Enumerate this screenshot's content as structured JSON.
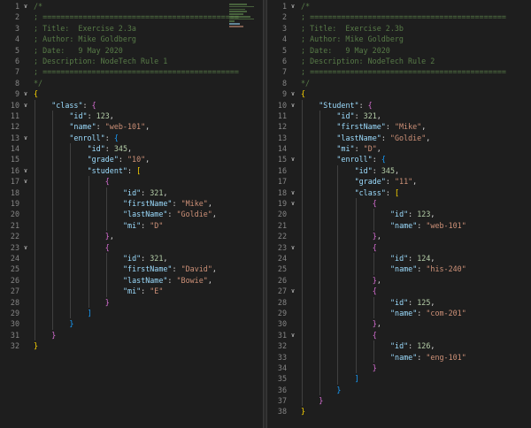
{
  "editors": [
    {
      "name": "left",
      "lines": [
        {
          "n": "1",
          "fold": true,
          "indent": 0,
          "tokens": [
            [
              "comment",
              "/*"
            ]
          ]
        },
        {
          "n": "2",
          "indent": 0,
          "tokens": [
            [
              "comment",
              "; ============================================"
            ]
          ]
        },
        {
          "n": "3",
          "indent": 0,
          "tokens": [
            [
              "comment",
              "; Title:  Exercise 2.3a"
            ]
          ]
        },
        {
          "n": "4",
          "indent": 0,
          "tokens": [
            [
              "comment",
              "; Author: Mike Goldberg"
            ]
          ]
        },
        {
          "n": "5",
          "indent": 0,
          "tokens": [
            [
              "comment",
              "; Date:   9 May 2020"
            ]
          ]
        },
        {
          "n": "6",
          "indent": 0,
          "tokens": [
            [
              "comment",
              "; Description: NodeTech Rule 1"
            ]
          ]
        },
        {
          "n": "7",
          "indent": 0,
          "tokens": [
            [
              "comment",
              "; ============================================"
            ]
          ]
        },
        {
          "n": "8",
          "indent": 0,
          "tokens": [
            [
              "comment",
              "*/"
            ]
          ]
        },
        {
          "n": "9",
          "fold": true,
          "indent": 0,
          "tokens": [
            [
              "b1",
              "{"
            ]
          ]
        },
        {
          "n": "10",
          "fold": true,
          "indent": 1,
          "tokens": [
            [
              "key",
              "\"class\""
            ],
            [
              "punc",
              ": "
            ],
            [
              "b2",
              "{"
            ]
          ]
        },
        {
          "n": "11",
          "indent": 2,
          "tokens": [
            [
              "key",
              "\"id\""
            ],
            [
              "punc",
              ": "
            ],
            [
              "num",
              "123"
            ],
            [
              "punc",
              ","
            ]
          ]
        },
        {
          "n": "12",
          "indent": 2,
          "tokens": [
            [
              "key",
              "\"name\""
            ],
            [
              "punc",
              ": "
            ],
            [
              "str",
              "\"web-101\""
            ],
            [
              "punc",
              ","
            ]
          ]
        },
        {
          "n": "13",
          "fold": true,
          "indent": 2,
          "tokens": [
            [
              "key",
              "\"enroll\""
            ],
            [
              "punc",
              ": "
            ],
            [
              "b3",
              "{"
            ]
          ]
        },
        {
          "n": "14",
          "indent": 3,
          "tokens": [
            [
              "key",
              "\"id\""
            ],
            [
              "punc",
              ": "
            ],
            [
              "num",
              "345"
            ],
            [
              "punc",
              ","
            ]
          ]
        },
        {
          "n": "15",
          "indent": 3,
          "tokens": [
            [
              "key",
              "\"grade\""
            ],
            [
              "punc",
              ": "
            ],
            [
              "str",
              "\"10\""
            ],
            [
              "punc",
              ","
            ]
          ]
        },
        {
          "n": "16",
          "fold": true,
          "indent": 3,
          "tokens": [
            [
              "key",
              "\"student\""
            ],
            [
              "punc",
              ": "
            ],
            [
              "b1",
              "["
            ]
          ]
        },
        {
          "n": "17",
          "fold": true,
          "indent": 4,
          "tokens": [
            [
              "b2",
              "{"
            ]
          ]
        },
        {
          "n": "18",
          "indent": 5,
          "tokens": [
            [
              "key",
              "\"id\""
            ],
            [
              "punc",
              ": "
            ],
            [
              "num",
              "321"
            ],
            [
              "punc",
              ","
            ]
          ]
        },
        {
          "n": "19",
          "indent": 5,
          "tokens": [
            [
              "key",
              "\"firstName\""
            ],
            [
              "punc",
              ": "
            ],
            [
              "str",
              "\"Mike\""
            ],
            [
              "punc",
              ","
            ]
          ]
        },
        {
          "n": "20",
          "indent": 5,
          "tokens": [
            [
              "key",
              "\"lastName\""
            ],
            [
              "punc",
              ": "
            ],
            [
              "str",
              "\"Goldie\""
            ],
            [
              "punc",
              ","
            ]
          ]
        },
        {
          "n": "21",
          "indent": 5,
          "tokens": [
            [
              "key",
              "\"mi\""
            ],
            [
              "punc",
              ": "
            ],
            [
              "str",
              "\"D\""
            ]
          ]
        },
        {
          "n": "22",
          "indent": 4,
          "tokens": [
            [
              "b2",
              "}"
            ],
            [
              "punc",
              ","
            ]
          ]
        },
        {
          "n": "23",
          "fold": true,
          "indent": 4,
          "tokens": [
            [
              "b2",
              "{"
            ]
          ]
        },
        {
          "n": "24",
          "indent": 5,
          "tokens": [
            [
              "key",
              "\"id\""
            ],
            [
              "punc",
              ": "
            ],
            [
              "num",
              "321"
            ],
            [
              "punc",
              ","
            ]
          ]
        },
        {
          "n": "25",
          "indent": 5,
          "tokens": [
            [
              "key",
              "\"firstName\""
            ],
            [
              "punc",
              ": "
            ],
            [
              "str",
              "\"David\""
            ],
            [
              "punc",
              ","
            ]
          ]
        },
        {
          "n": "26",
          "indent": 5,
          "tokens": [
            [
              "key",
              "\"lastName\""
            ],
            [
              "punc",
              ": "
            ],
            [
              "str",
              "\"Bowie\""
            ],
            [
              "punc",
              ","
            ]
          ]
        },
        {
          "n": "27",
          "indent": 5,
          "tokens": [
            [
              "key",
              "\"mi\""
            ],
            [
              "punc",
              ": "
            ],
            [
              "str",
              "\"E\""
            ]
          ]
        },
        {
          "n": "28",
          "indent": 4,
          "tokens": [
            [
              "b2",
              "}"
            ]
          ]
        },
        {
          "n": "29",
          "indent": 3,
          "tokens": [
            [
              "b3",
              "]"
            ]
          ]
        },
        {
          "n": "30",
          "indent": 2,
          "tokens": [
            [
              "b3",
              "}"
            ]
          ]
        },
        {
          "n": "31",
          "indent": 1,
          "tokens": [
            [
              "b2",
              "}"
            ]
          ]
        },
        {
          "n": "32",
          "indent": 0,
          "tokens": [
            [
              "b1",
              "}"
            ]
          ]
        }
      ]
    },
    {
      "name": "right",
      "lines": [
        {
          "n": "1",
          "fold": true,
          "indent": 0,
          "tokens": [
            [
              "comment",
              "/*"
            ]
          ]
        },
        {
          "n": "2",
          "indent": 0,
          "tokens": [
            [
              "comment",
              "; ============================================"
            ]
          ]
        },
        {
          "n": "3",
          "indent": 0,
          "tokens": [
            [
              "comment",
              "; Title:  Exercise 2.3b"
            ]
          ]
        },
        {
          "n": "4",
          "indent": 0,
          "tokens": [
            [
              "comment",
              "; Author: Mike Goldberg"
            ]
          ]
        },
        {
          "n": "5",
          "indent": 0,
          "tokens": [
            [
              "comment",
              "; Date:   9 May 2020"
            ]
          ]
        },
        {
          "n": "6",
          "indent": 0,
          "tokens": [
            [
              "comment",
              "; Description: NodeTech Rule 2"
            ]
          ]
        },
        {
          "n": "7",
          "indent": 0,
          "tokens": [
            [
              "comment",
              "; ============================================"
            ]
          ]
        },
        {
          "n": "8",
          "indent": 0,
          "tokens": [
            [
              "comment",
              "*/"
            ]
          ]
        },
        {
          "n": "9",
          "fold": true,
          "indent": 0,
          "tokens": [
            [
              "b1",
              "{"
            ]
          ]
        },
        {
          "n": "10",
          "fold": true,
          "indent": 1,
          "tokens": [
            [
              "key",
              "\"Student\""
            ],
            [
              "punc",
              ": "
            ],
            [
              "b2",
              "{"
            ]
          ]
        },
        {
          "n": "11",
          "indent": 2,
          "tokens": [
            [
              "key",
              "\"id\""
            ],
            [
              "punc",
              ": "
            ],
            [
              "num",
              "321"
            ],
            [
              "punc",
              ","
            ]
          ]
        },
        {
          "n": "12",
          "indent": 2,
          "tokens": [
            [
              "key",
              "\"firstName\""
            ],
            [
              "punc",
              ": "
            ],
            [
              "str",
              "\"Mike\""
            ],
            [
              "punc",
              ","
            ]
          ]
        },
        {
          "n": "13",
          "indent": 2,
          "tokens": [
            [
              "key",
              "\"lastName\""
            ],
            [
              "punc",
              ": "
            ],
            [
              "str",
              "\"Goldie\""
            ],
            [
              "punc",
              ","
            ]
          ]
        },
        {
          "n": "14",
          "indent": 2,
          "tokens": [
            [
              "key",
              "\"mi\""
            ],
            [
              "punc",
              ": "
            ],
            [
              "str",
              "\"D\""
            ],
            [
              "punc",
              ","
            ]
          ]
        },
        {
          "n": "15",
          "fold": true,
          "indent": 2,
          "tokens": [
            [
              "key",
              "\"enroll\""
            ],
            [
              "punc",
              ": "
            ],
            [
              "b3",
              "{"
            ]
          ]
        },
        {
          "n": "16",
          "indent": 3,
          "tokens": [
            [
              "key",
              "\"id\""
            ],
            [
              "punc",
              ": "
            ],
            [
              "num",
              "345"
            ],
            [
              "punc",
              ","
            ]
          ]
        },
        {
          "n": "17",
          "indent": 3,
          "tokens": [
            [
              "key",
              "\"grade\""
            ],
            [
              "punc",
              ": "
            ],
            [
              "str",
              "\"11\""
            ],
            [
              "punc",
              ","
            ]
          ]
        },
        {
          "n": "18",
          "fold": true,
          "indent": 3,
          "tokens": [
            [
              "key",
              "\"class\""
            ],
            [
              "punc",
              ": "
            ],
            [
              "b1",
              "["
            ]
          ]
        },
        {
          "n": "19",
          "fold": true,
          "indent": 4,
          "tokens": [
            [
              "b2",
              "{"
            ]
          ]
        },
        {
          "n": "20",
          "indent": 5,
          "tokens": [
            [
              "key",
              "\"id\""
            ],
            [
              "punc",
              ": "
            ],
            [
              "num",
              "123"
            ],
            [
              "punc",
              ","
            ]
          ]
        },
        {
          "n": "21",
          "indent": 5,
          "tokens": [
            [
              "key",
              "\"name\""
            ],
            [
              "punc",
              ": "
            ],
            [
              "str",
              "\"web-101\""
            ]
          ]
        },
        {
          "n": "22",
          "indent": 4,
          "tokens": [
            [
              "b2",
              "}"
            ],
            [
              "punc",
              ","
            ]
          ]
        },
        {
          "n": "23",
          "fold": true,
          "indent": 4,
          "tokens": [
            [
              "b2",
              "{"
            ]
          ]
        },
        {
          "n": "24",
          "indent": 5,
          "tokens": [
            [
              "key",
              "\"id\""
            ],
            [
              "punc",
              ": "
            ],
            [
              "num",
              "124"
            ],
            [
              "punc",
              ","
            ]
          ]
        },
        {
          "n": "25",
          "indent": 5,
          "tokens": [
            [
              "key",
              "\"name\""
            ],
            [
              "punc",
              ": "
            ],
            [
              "str",
              "\"his-240\""
            ]
          ]
        },
        {
          "n": "26",
          "indent": 4,
          "tokens": [
            [
              "b2",
              "}"
            ],
            [
              "punc",
              ","
            ]
          ]
        },
        {
          "n": "27",
          "fold": true,
          "indent": 4,
          "tokens": [
            [
              "b2",
              "{"
            ]
          ]
        },
        {
          "n": "28",
          "indent": 5,
          "tokens": [
            [
              "key",
              "\"id\""
            ],
            [
              "punc",
              ": "
            ],
            [
              "num",
              "125"
            ],
            [
              "punc",
              ","
            ]
          ]
        },
        {
          "n": "29",
          "indent": 5,
          "tokens": [
            [
              "key",
              "\"name\""
            ],
            [
              "punc",
              ": "
            ],
            [
              "str",
              "\"com-201\""
            ]
          ]
        },
        {
          "n": "30",
          "indent": 4,
          "tokens": [
            [
              "b2",
              "}"
            ],
            [
              "punc",
              ","
            ]
          ]
        },
        {
          "n": "31",
          "fold": true,
          "indent": 4,
          "tokens": [
            [
              "b2",
              "{"
            ]
          ]
        },
        {
          "n": "32",
          "indent": 5,
          "tokens": [
            [
              "key",
              "\"id\""
            ],
            [
              "punc",
              ": "
            ],
            [
              "num",
              "126"
            ],
            [
              "punc",
              ","
            ]
          ]
        },
        {
          "n": "33",
          "indent": 5,
          "tokens": [
            [
              "key",
              "\"name\""
            ],
            [
              "punc",
              ": "
            ],
            [
              "str",
              "\"eng-101\""
            ]
          ]
        },
        {
          "n": "34",
          "indent": 4,
          "tokens": [
            [
              "b2",
              "}"
            ]
          ]
        },
        {
          "n": "35",
          "indent": 3,
          "tokens": [
            [
              "b3",
              "]"
            ]
          ]
        },
        {
          "n": "36",
          "indent": 2,
          "tokens": [
            [
              "b3",
              "}"
            ]
          ]
        },
        {
          "n": "37",
          "indent": 1,
          "tokens": [
            [
              "b2",
              "}"
            ]
          ]
        },
        {
          "n": "38",
          "indent": 0,
          "tokens": [
            [
              "b1",
              "}"
            ]
          ]
        }
      ]
    }
  ]
}
